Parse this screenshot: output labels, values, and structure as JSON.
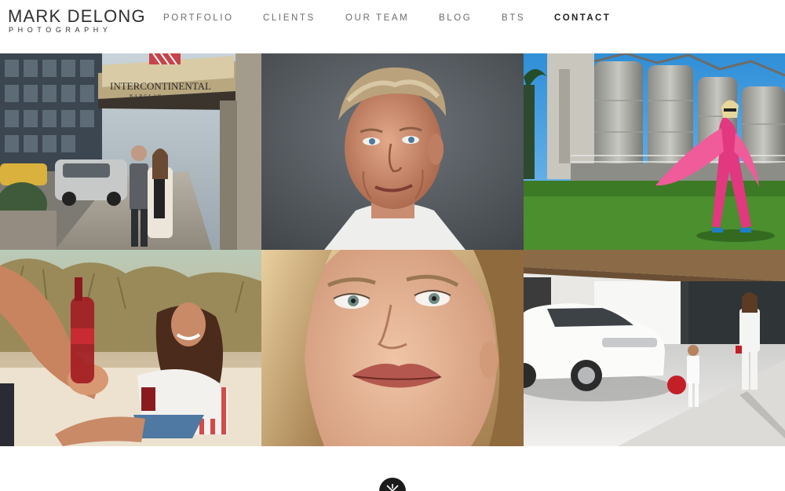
{
  "brand": {
    "name": "MARK DELONG",
    "tagline": "PHOTOGRAPHY"
  },
  "nav": {
    "items": [
      {
        "label": "PORTFOLIO",
        "active": false
      },
      {
        "label": "CLIENTS",
        "active": false
      },
      {
        "label": "OUR TEAM",
        "active": false
      },
      {
        "label": "BLOG",
        "active": false
      },
      {
        "label": "BTS",
        "active": false
      },
      {
        "label": "CONTACT",
        "active": true
      }
    ]
  },
  "hotel_sign": {
    "name": "INTERCONTINENTAL",
    "sub": "BARCLAY"
  },
  "gallery": {
    "tiles": [
      {
        "subject": "hotel-couple-photo"
      },
      {
        "subject": "chef-portrait-photo"
      },
      {
        "subject": "pink-fashion-industrial-photo"
      },
      {
        "subject": "beach-cola-photo"
      },
      {
        "subject": "beauty-closeup-photo"
      },
      {
        "subject": "white-car-family-photo"
      }
    ]
  },
  "footer": {
    "icon": "camera-shutter-icon"
  },
  "colors": {
    "text": "#2f2f2f",
    "nav": "#6b6b6b",
    "nav_active": "#222222",
    "footer_icon_bg": "#1c1c1c"
  }
}
